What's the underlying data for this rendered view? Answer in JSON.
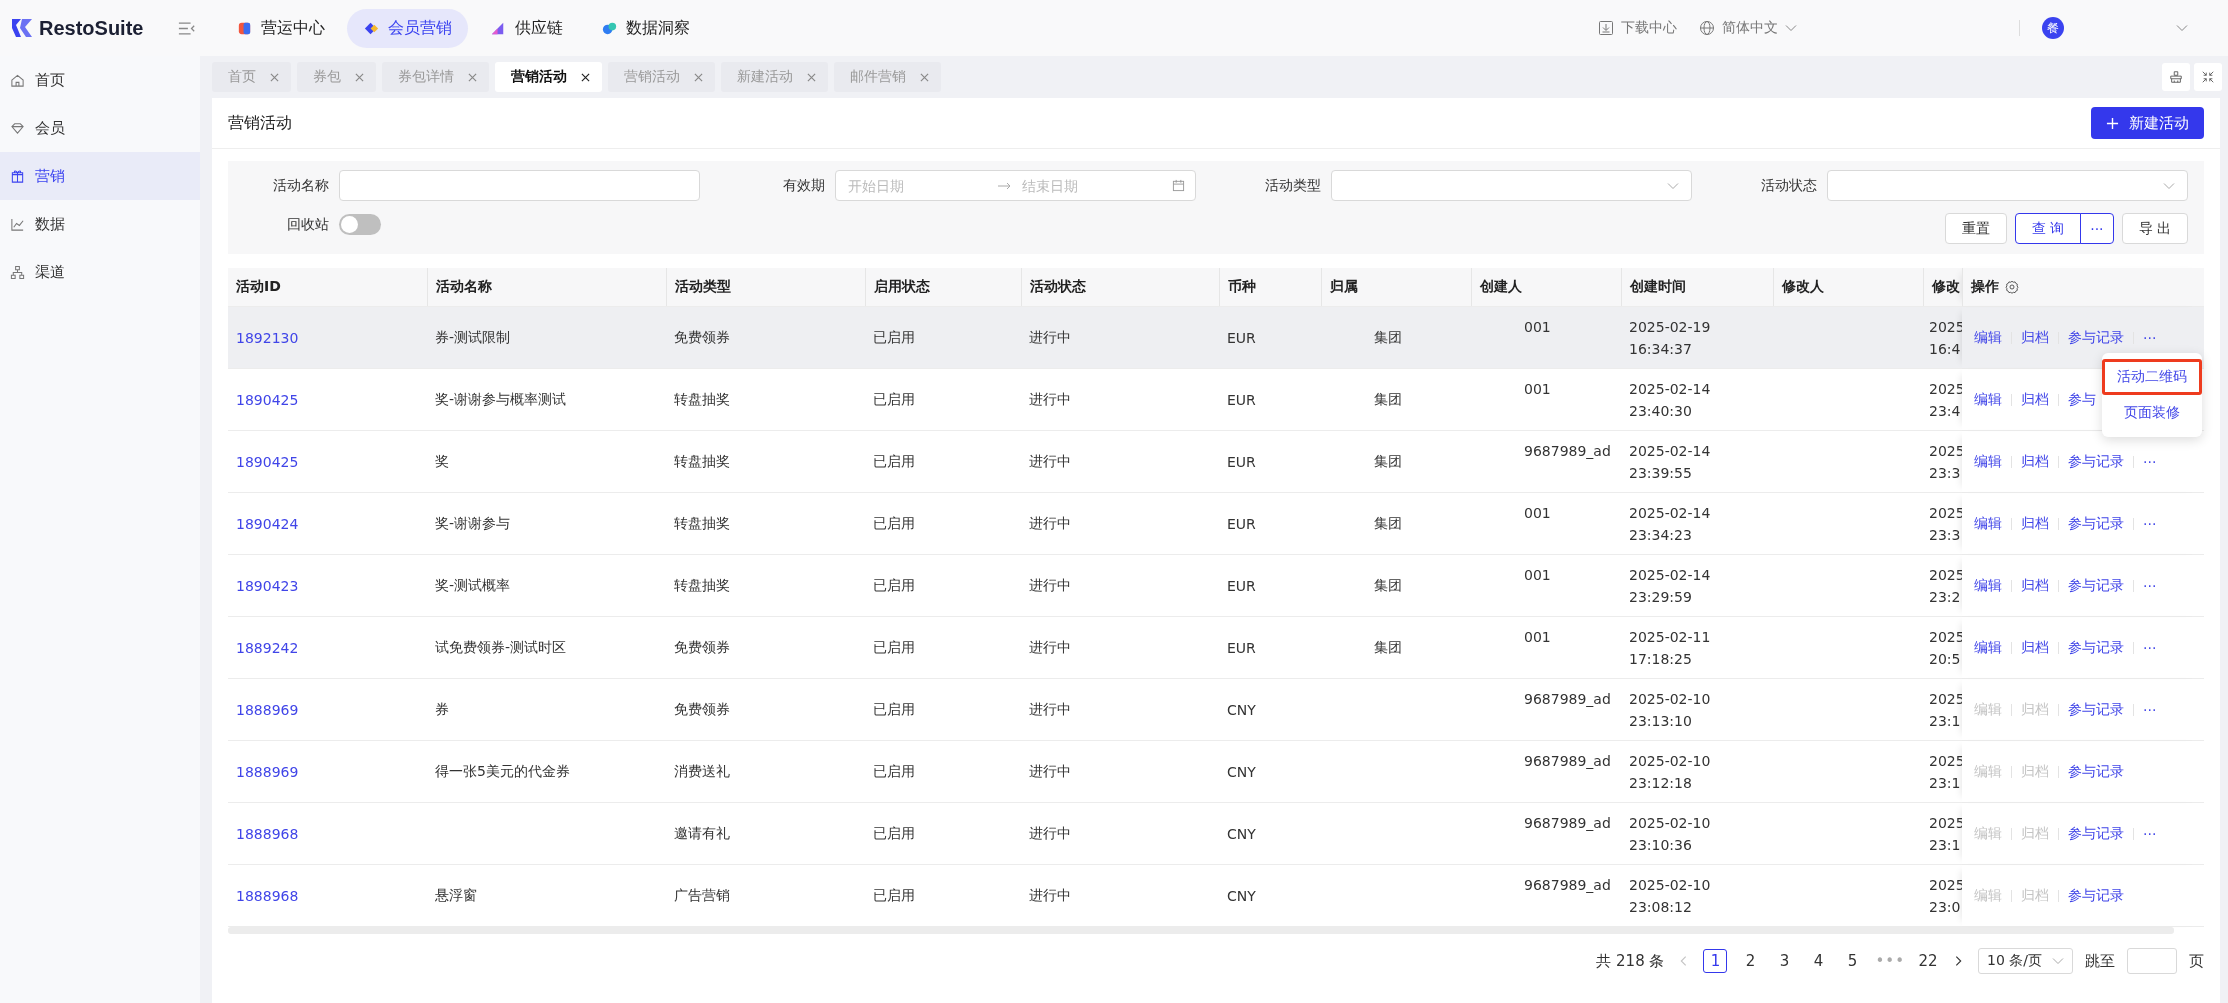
{
  "app": {
    "logo": "RestoSuite"
  },
  "top_nav": [
    {
      "label": "营运中心",
      "selected": false,
      "kind": "cube",
      "color": "#f2553d"
    },
    {
      "label": "会员营销",
      "selected": true,
      "kind": "diamond",
      "color": "#3b43f0"
    },
    {
      "label": "供应链",
      "selected": false,
      "kind": "chain",
      "color": "#7b5cf0"
    },
    {
      "label": "数据洞察",
      "selected": false,
      "kind": "bubbles",
      "color": "#2f7df2"
    }
  ],
  "header_right": {
    "download": "下载中心",
    "language": "简体中文",
    "avatar": "餐"
  },
  "sidebar": [
    {
      "label": "首页",
      "kind": "home",
      "selected": false
    },
    {
      "label": "会员",
      "kind": "member",
      "selected": false
    },
    {
      "label": "营销",
      "kind": "gift",
      "selected": true
    },
    {
      "label": "数据",
      "kind": "chart",
      "selected": false
    },
    {
      "label": "渠道",
      "kind": "tree",
      "selected": false
    }
  ],
  "tabs": [
    {
      "label": "首页",
      "selected": false
    },
    {
      "label": "券包",
      "selected": false
    },
    {
      "label": "券包详情",
      "selected": false
    },
    {
      "label": "营销活动",
      "selected": true
    },
    {
      "label": "营销活动",
      "selected": false
    },
    {
      "label": "新建活动",
      "selected": false
    },
    {
      "label": "邮件营销",
      "selected": false
    }
  ],
  "page": {
    "title": "营销活动",
    "new_button": "新建活动"
  },
  "filters": {
    "name": {
      "label": "活动名称"
    },
    "period": {
      "label": "有效期",
      "start_placeholder": "开始日期",
      "end_placeholder": "结束日期"
    },
    "type": {
      "label": "活动类型"
    },
    "status": {
      "label": "活动状态"
    },
    "recycle": {
      "label": "回收站",
      "on": false
    }
  },
  "buttons": {
    "reset": "重置",
    "query": "查 询",
    "more": "···",
    "export": "导 出"
  },
  "table": {
    "columns": [
      "活动ID",
      "活动名称",
      "活动类型",
      "启用状态",
      "活动状态",
      "币种",
      "归属",
      "创建人",
      "创建时间",
      "修改人",
      "修改",
      "操作"
    ],
    "rows": [
      {
        "id": "1892130",
        "name": "券-测试限制",
        "type": "免费领券",
        "enabled": "已启用",
        "status": "进行中",
        "currency": "EUR",
        "owner": "集团",
        "creator": "001",
        "created_date": "2025-02-19",
        "created_time": "16:34:37",
        "modified_date": "2025",
        "modified_time": "16:4",
        "hovered": true,
        "actions": [
          {
            "label": "编辑",
            "disabled": false
          },
          {
            "label": "归档",
            "disabled": false
          },
          {
            "label": "参与记录",
            "disabled": false
          }
        ],
        "more": "···",
        "menu": [
          {
            "label": "活动二维码",
            "highlighted": true
          },
          {
            "label": "页面装修",
            "highlighted": false
          }
        ]
      },
      {
        "id": "1890425",
        "name": "奖-谢谢参与概率测试",
        "type": "转盘抽奖",
        "enabled": "已启用",
        "status": "进行中",
        "currency": "EUR",
        "owner": "集团",
        "creator": "001",
        "created_date": "2025-02-14",
        "created_time": "23:40:30",
        "modified_date": "2025",
        "modified_time": "23:4",
        "hovered": false,
        "actions": [
          {
            "label": "编辑",
            "disabled": false
          },
          {
            "label": "归档",
            "disabled": false
          },
          {
            "label": "参与",
            "disabled": false
          }
        ]
      },
      {
        "id": "1890425",
        "name": "奖",
        "type": "转盘抽奖",
        "enabled": "已启用",
        "status": "进行中",
        "currency": "EUR",
        "owner": "集团",
        "creator": "9687989_ad",
        "created_date": "2025-02-14",
        "created_time": "23:39:55",
        "modified_date": "2025",
        "modified_time": "23:3",
        "hovered": false,
        "actions": [
          {
            "label": "编辑",
            "disabled": false
          },
          {
            "label": "归档",
            "disabled": false
          },
          {
            "label": "参与记录",
            "disabled": false
          }
        ],
        "more": "···"
      },
      {
        "id": "1890424",
        "name": "奖-谢谢参与",
        "type": "转盘抽奖",
        "enabled": "已启用",
        "status": "进行中",
        "currency": "EUR",
        "owner": "集团",
        "creator": "001",
        "created_date": "2025-02-14",
        "created_time": "23:34:23",
        "modified_date": "2025",
        "modified_time": "23:3",
        "hovered": false,
        "actions": [
          {
            "label": "编辑",
            "disabled": false
          },
          {
            "label": "归档",
            "disabled": false
          },
          {
            "label": "参与记录",
            "disabled": false
          }
        ],
        "more": "···"
      },
      {
        "id": "1890423",
        "name": "奖-测试概率",
        "type": "转盘抽奖",
        "enabled": "已启用",
        "status": "进行中",
        "currency": "EUR",
        "owner": "集团",
        "creator": "001",
        "created_date": "2025-02-14",
        "created_time": "23:29:59",
        "modified_date": "2025",
        "modified_time": "23:2",
        "hovered": false,
        "actions": [
          {
            "label": "编辑",
            "disabled": false
          },
          {
            "label": "归档",
            "disabled": false
          },
          {
            "label": "参与记录",
            "disabled": false
          }
        ],
        "more": "···"
      },
      {
        "id": "1889242",
        "name": "试免费领券-测试时区",
        "type": "免费领券",
        "enabled": "已启用",
        "status": "进行中",
        "currency": "EUR",
        "owner": "集团",
        "creator": "001",
        "created_date": "2025-02-11",
        "created_time": "17:18:25",
        "modified_date": "2025",
        "modified_time": "20:5",
        "hovered": false,
        "actions": [
          {
            "label": "编辑",
            "disabled": false
          },
          {
            "label": "归档",
            "disabled": false
          },
          {
            "label": "参与记录",
            "disabled": false
          }
        ],
        "more": "···"
      },
      {
        "id": "1888969",
        "name": "券",
        "type": "免费领券",
        "enabled": "已启用",
        "status": "进行中",
        "currency": "CNY",
        "creator": "9687989_ad",
        "created_date": "2025-02-10",
        "created_time": "23:13:10",
        "modified_date": "2025",
        "modified_time": "23:1",
        "hovered": false,
        "actions": [
          {
            "label": "编辑",
            "disabled": true
          },
          {
            "label": "归档",
            "disabled": true
          },
          {
            "label": "参与记录",
            "disabled": false
          }
        ],
        "more": "···"
      },
      {
        "id": "1888969",
        "name": "得一张5美元的代金券",
        "type": "消费送礼",
        "enabled": "已启用",
        "status": "进行中",
        "currency": "CNY",
        "creator": "9687989_ad",
        "created_date": "2025-02-10",
        "created_time": "23:12:18",
        "modified_date": "2025",
        "modified_time": "23:1",
        "hovered": false,
        "actions": [
          {
            "label": "编辑",
            "disabled": true
          },
          {
            "label": "归档",
            "disabled": true
          },
          {
            "label": "参与记录",
            "disabled": false
          }
        ]
      },
      {
        "id": "1888968",
        "type": "邀请有礼",
        "enabled": "已启用",
        "status": "进行中",
        "currency": "CNY",
        "creator": "9687989_ad",
        "created_date": "2025-02-10",
        "created_time": "23:10:36",
        "modified_date": "2025",
        "modified_time": "23:1",
        "hovered": false,
        "actions": [
          {
            "label": "编辑",
            "disabled": true
          },
          {
            "label": "归档",
            "disabled": true
          },
          {
            "label": "参与记录",
            "disabled": false
          }
        ],
        "more": "···"
      },
      {
        "id": "1888968",
        "name": "悬浮窗",
        "type": "广告营销",
        "enabled": "已启用",
        "status": "进行中",
        "currency": "CNY",
        "creator": "9687989_ad",
        "created_date": "2025-02-10",
        "created_time": "23:08:12",
        "modified_date": "2025",
        "modified_time": "23:0",
        "hovered": false,
        "actions": [
          {
            "label": "编辑",
            "disabled": true
          },
          {
            "label": "归档",
            "disabled": true
          },
          {
            "label": "参与记录",
            "disabled": false
          }
        ]
      }
    ]
  },
  "pagination": {
    "total": "共 218 条",
    "prev_disabled": true,
    "pages": [
      {
        "label": "1",
        "kind": "page",
        "selected": true
      },
      {
        "label": "2",
        "kind": "page",
        "selected": false
      },
      {
        "label": "3",
        "kind": "page",
        "selected": false
      },
      {
        "label": "4",
        "kind": "page",
        "selected": false
      },
      {
        "label": "5",
        "kind": "page",
        "selected": false
      },
      {
        "label": "•••",
        "kind": "ellipsis",
        "selected": false
      },
      {
        "label": "22",
        "kind": "page",
        "selected": false
      }
    ],
    "page_size": "10 条/页",
    "jump_label": "跳至",
    "page_suffix": "页"
  }
}
